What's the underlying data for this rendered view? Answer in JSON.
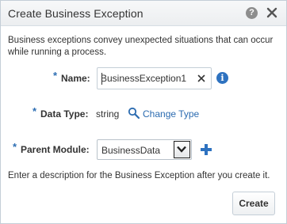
{
  "dialog": {
    "title": "Create Business Exception",
    "help_label": "?",
    "intro": "Business exceptions convey unexpected situations that can occur while running a process."
  },
  "form": {
    "required_marker": "*",
    "name": {
      "label": "Name:",
      "value": "BusinessException1"
    },
    "data_type": {
      "label": "Data Type:",
      "value": "string",
      "change_link": "Change Type"
    },
    "parent_module": {
      "label": "Parent Module:",
      "selected": "BusinessData"
    },
    "info_glyph": "i"
  },
  "footer": {
    "description": "Enter a description for the Business Exception after you create it.",
    "create_label": "Create"
  },
  "colors": {
    "accent": "#2d6eb3",
    "link": "#2b6bb0",
    "add_icon": "#2e72c0"
  }
}
